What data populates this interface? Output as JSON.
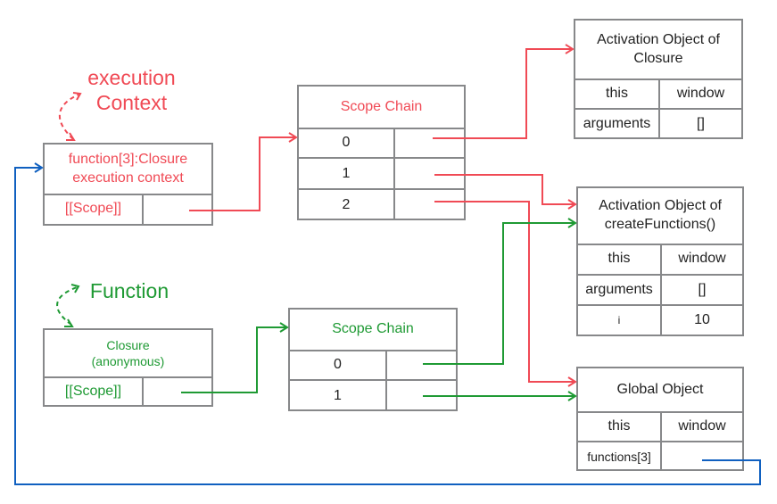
{
  "colors": {
    "border": "#87888a",
    "red": "#f04a55",
    "green": "#1f9a34",
    "blue": "#1060c0"
  },
  "labels": {
    "execution_context": [
      "execution",
      "Context"
    ],
    "function": "Function"
  },
  "exec_context": {
    "title": [
      "function[3]:Closure",
      "execution context"
    ],
    "scope_label": "[[Scope]]"
  },
  "closure_fn": {
    "title": [
      "Closure",
      "(anonymous)"
    ],
    "scope_label": "[[Scope]]"
  },
  "scope_chain_1": {
    "title": "Scope Chain",
    "rows": [
      "0",
      "1",
      "2"
    ]
  },
  "scope_chain_2": {
    "title": "Scope Chain",
    "rows": [
      "0",
      "1"
    ]
  },
  "ao_closure": {
    "title": [
      "Activation Object of",
      "Closure"
    ],
    "rows": [
      [
        "this",
        "window"
      ],
      [
        "arguments",
        "[]"
      ]
    ]
  },
  "ao_create": {
    "title": [
      "Activation Object of",
      "createFunctions()"
    ],
    "rows": [
      [
        "this",
        "window"
      ],
      [
        "arguments",
        "[]"
      ],
      [
        "i",
        "10"
      ]
    ]
  },
  "global": {
    "title": "Global Object",
    "rows": [
      [
        "this",
        "window"
      ],
      [
        "functions[3]",
        ""
      ]
    ]
  }
}
